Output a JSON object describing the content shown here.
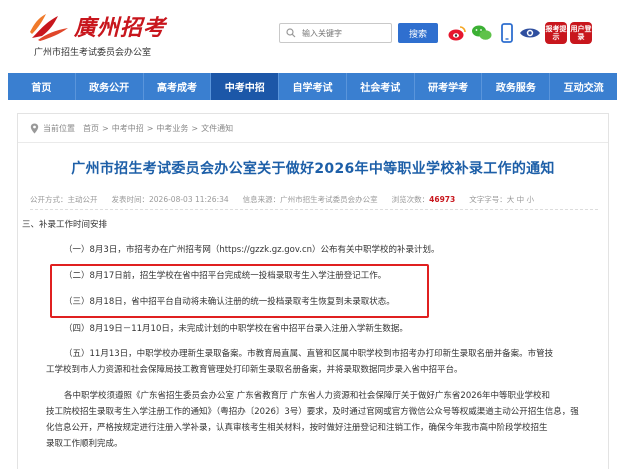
{
  "header": {
    "logo_text": "廣州招考",
    "site_subtitle": "广州市招生考试委员会办公室",
    "search_placeholder": "输入关键字",
    "search_button": "搜索",
    "icons": [
      "weibo-icon",
      "wechat-icon",
      "mobile-icon",
      "eye-icon",
      "tips-icon",
      "user-icon"
    ],
    "tips_label": "报考提示",
    "user_label": "用户登录"
  },
  "nav": {
    "items": [
      "首页",
      "政务公开",
      "高考成考",
      "中考中招",
      "自学考试",
      "社会考试",
      "研考学考",
      "政务服务",
      "互动交流"
    ],
    "active_index": 3
  },
  "breadcrumb": {
    "label": "当前位置",
    "items": [
      "首页",
      ">",
      "中考中招",
      ">",
      "中考业务",
      ">",
      "文件通知"
    ]
  },
  "article": {
    "title": "广州市招生考试委员会办公室关于做好2026年中等职业学校补录工作的通知",
    "meta": {
      "open_mode": "公开方式：主动公开",
      "publish_time": "发表时间：2026-08-03 11:26:34",
      "source": "信息来源：广州市招生考试委员会办公室",
      "views_label": "浏览次数：",
      "views": "46973",
      "font_size": "文字字号：大 中 小"
    },
    "section_heading": "三、补录工作时间安排",
    "p1": "（一）8月3日，市招考办在广州招考网（https://gzzk.gz.gov.cn）公布有关中职学校的补录计划。",
    "p2": "（二）8月17日前，招生学校在省中招平台完成统一投档录取考生入学注册登记工作。",
    "p3": "（三）8月18日，省中招平台自动将未确认注册的统一投档录取考生恢复到未录取状态。",
    "p4": "（四）8月19日－11月10日，未完成计划的中职学校在省中招平台录入注册入学新生数据。",
    "p5_line1": "（五）11月13日，中职学校办理新生录取备案。市教育局直属、直管和区属中职学校到市招考办打印新生录取名册并备案。市管技",
    "p5_line2": "工学校到市人力资源和社会保障局技工教育管理处打印新生录取名册备案，并将录取数据同步录入省中招平台。",
    "p6_line1": "各中职学校须遵照《广东省招生委员会办公室 广东省教育厅 广东省人力资源和社会保障厅关于做好广东省2026年中等职业学校和",
    "p6_line2": "技工院校招生录取考生入学注册工作的通知》（粤招办〔2026〕3号）要求，及时通过官网或官方微信公众号等权威渠道主动公开招生信息，强",
    "p6_line3": "化信息公开，严格按规定进行注册入学补录，认真审核考生相关材料，按时做好注册登记和注销工作，确保今年我市高中阶段学校招生",
    "p6_line4": "录取工作顺利完成。"
  },
  "colors": {
    "nav_bg": "#3a7fd0",
    "nav_active": "#1c57a8",
    "title": "#1d5fa8",
    "brand_red": "#c8161d",
    "highlight_border": "#e02020"
  }
}
